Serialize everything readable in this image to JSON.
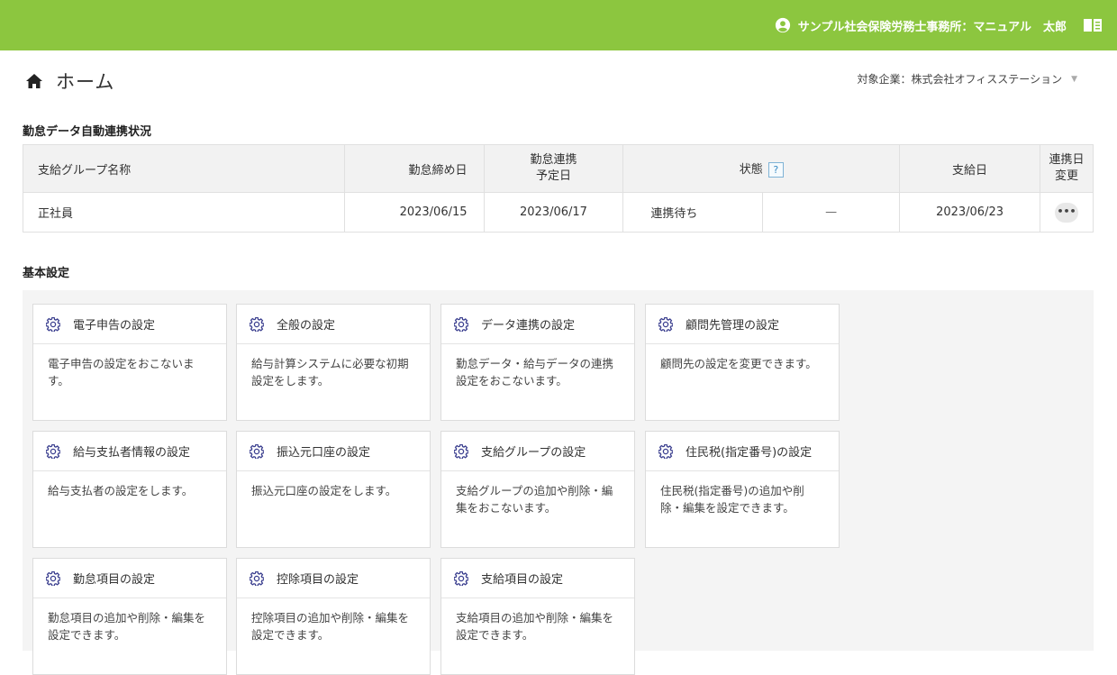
{
  "header": {
    "user_label": "サンプル社会保険労務士事務所：マニュアル　太郎"
  },
  "page": {
    "title": "ホーム",
    "company_label": "対象企業：株式会社オフィスステーション"
  },
  "sync_section": {
    "title": "勤怠データ自動連携状況",
    "columns": [
      "支給グループ名称",
      "勤怠締め日",
      "勤怠連携\n予定日",
      "状態",
      "支給日",
      "連携日\n変更"
    ],
    "help_mark": "?",
    "rows": [
      {
        "group": "正社員",
        "close_date": "2023/06/15",
        "sync_date": "2023/06/17",
        "status": "連携待ち",
        "status_detail": "—",
        "pay_date": "2023/06/23",
        "action": "•••"
      }
    ]
  },
  "settings_section": {
    "title": "基本設定",
    "cards": [
      {
        "title": "電子申告の設定",
        "desc": "電子申告の設定をおこないま\nす。"
      },
      {
        "title": "全般の設定",
        "desc": "給与計算システムに必要な初期\n設定をします。"
      },
      {
        "title": "データ連携の設定",
        "desc": "勤怠データ・給与データの連携\n設定をおこないます。"
      },
      {
        "title": "顧問先管理の設定",
        "desc": "顧問先の設定を変更できます。"
      },
      {
        "title": "給与支払者情報の設定",
        "desc": "給与支払者の設定をします。"
      },
      {
        "title": "振込元口座の設定",
        "desc": "振込元口座の設定をします。"
      },
      {
        "title": "支給グループの設定",
        "desc": "支給グループの追加や削除・編\n集をおこないます。"
      },
      {
        "title": "住民税(指定番号)の設定",
        "desc": "住民税(指定番号)の追加や削\n除・編集を設定できます。"
      },
      {
        "title": "勤怠項目の設定",
        "desc": "勤怠項目の追加や削除・編集を\n設定できます。"
      },
      {
        "title": "控除項目の設定",
        "desc": "控除項目の追加や削除・編集を\n設定できます。"
      },
      {
        "title": "支給項目の設定",
        "desc": "支給項目の追加や削除・編集を\n設定できます。"
      }
    ]
  },
  "colors": {
    "topbar": "#8cc63f",
    "gear": "#3b3f8f"
  },
  "icons": {
    "user": "user-circle-icon",
    "manual": "book-icon",
    "home": "home-icon",
    "gear": "gear-icon",
    "help": "help-icon"
  }
}
